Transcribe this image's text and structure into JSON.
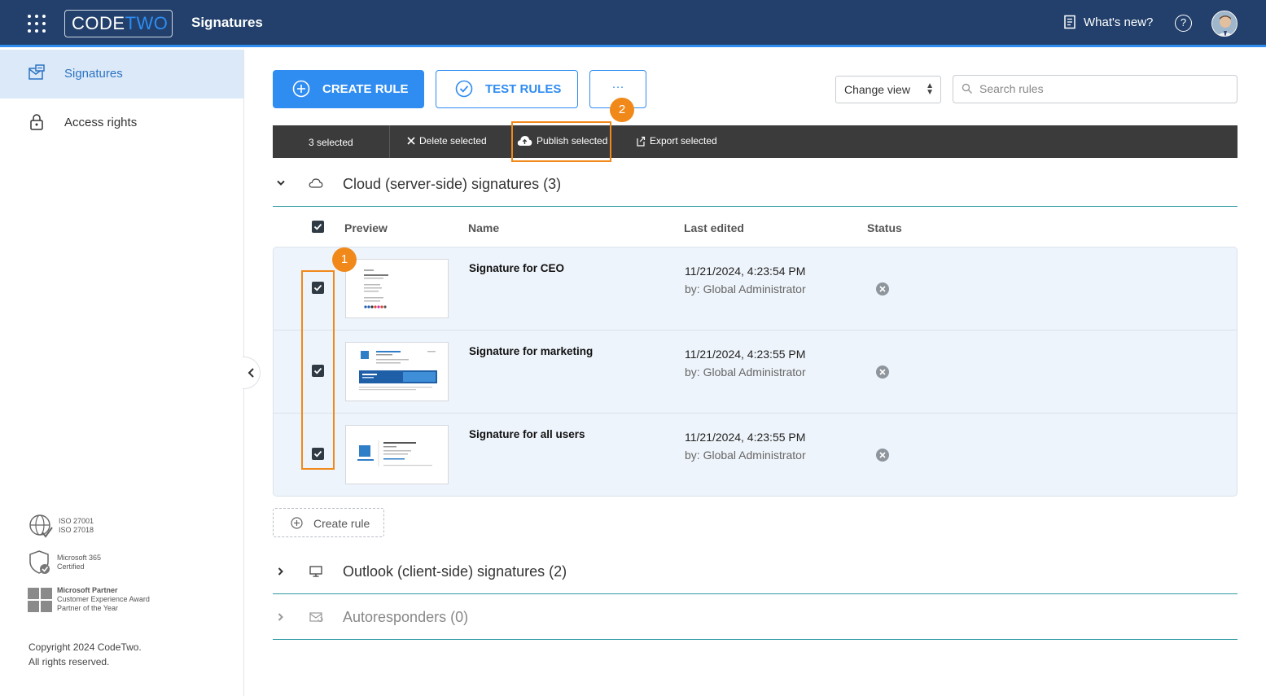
{
  "header": {
    "logo_code": "CODE",
    "logo_two": "TWO",
    "app_title": "Signatures",
    "whats_new": "What's new?",
    "help_glyph": "?"
  },
  "sidebar": {
    "items": [
      {
        "label": "Signatures",
        "icon": "signature-icon",
        "active": true
      },
      {
        "label": "Access rights",
        "icon": "lock-icon",
        "active": false
      }
    ],
    "badges": [
      {
        "lines": [
          "ISO 27001",
          "ISO 27018"
        ],
        "icon": "iso-globe-icon"
      },
      {
        "lines": [
          "Microsoft 365",
          "Certified"
        ],
        "icon": "shield-check-icon"
      },
      {
        "lines": [
          "Microsoft Partner",
          "Customer Experience Award",
          "Partner of the Year"
        ],
        "icon": "microsoft-logo-icon"
      }
    ],
    "copyright_line1": "Copyright 2024 CodeTwo.",
    "copyright_line2": "All rights reserved."
  },
  "toolbar": {
    "create_rule": "CREATE RULE",
    "test_rules": "TEST RULES",
    "more": "···",
    "change_view": "Change view",
    "search_placeholder": "Search rules"
  },
  "selection_bar": {
    "count": "3  selected",
    "delete": "Delete selected",
    "publish": "Publish selected",
    "export": "Export selected"
  },
  "sections": [
    {
      "title": "Cloud (server-side) signatures (3)",
      "expanded": true
    },
    {
      "title": "Outlook (client-side) signatures (2)",
      "expanded": false
    },
    {
      "title": "Autoresponders (0)",
      "expanded": false
    }
  ],
  "table": {
    "headers": {
      "preview": "Preview",
      "name": "Name",
      "last_edited": "Last edited",
      "status": "Status"
    },
    "rows": [
      {
        "name": "Signature for CEO",
        "date": "11/21/2024, 4:23:54 PM",
        "by": "by: Global Administrator",
        "checked": true
      },
      {
        "name": "Signature for marketing",
        "date": "11/21/2024, 4:23:55 PM",
        "by": "by: Global Administrator",
        "checked": true
      },
      {
        "name": "Signature for all users",
        "date": "11/21/2024, 4:23:55 PM",
        "by": "by: Global Administrator",
        "checked": true
      }
    ]
  },
  "create_rule_inline": "Create rule",
  "annotations": {
    "marker1": "1",
    "marker2": "2"
  },
  "colors": {
    "topbar": "#22406b",
    "accent": "#2f8cf0",
    "highlight": "#f0891a",
    "selection_bar": "#3b3b3b"
  }
}
